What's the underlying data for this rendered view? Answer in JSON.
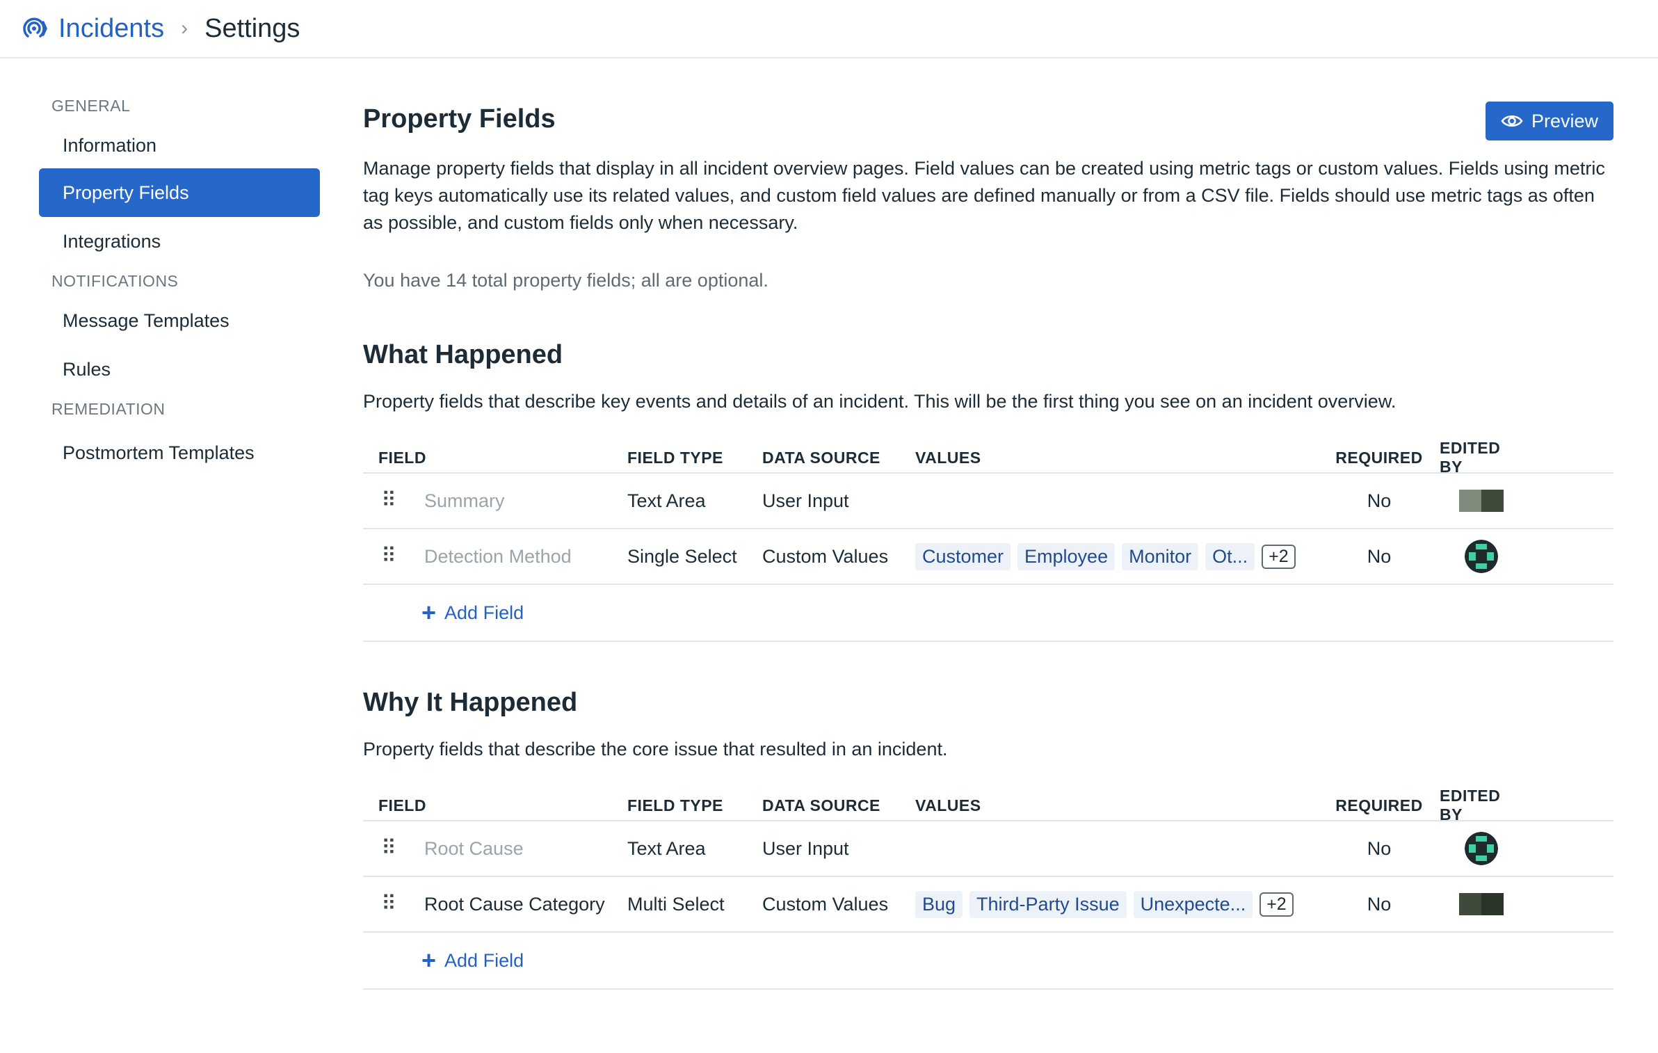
{
  "header": {
    "app": "Incidents",
    "page": "Settings"
  },
  "sidebar": {
    "sections": [
      {
        "title": "GENERAL",
        "items": [
          "Information",
          "Property Fields",
          "Integrations"
        ]
      },
      {
        "title": "NOTIFICATIONS",
        "items": [
          "Message Templates",
          "Rules"
        ]
      },
      {
        "title": "REMEDIATION",
        "items": [
          "Postmortem Templates"
        ]
      }
    ],
    "active": "Property Fields"
  },
  "main": {
    "title": "Property Fields",
    "preview_label": "Preview",
    "description": "Manage property fields that display in all incident overview pages. Field values can be created using metric tags or custom values. Fields using metric tag keys automatically use its related values, and custom field values are defined manually or from a CSV file. Fields should use metric tags as often as possible, and custom fields only when necessary.",
    "summary": "You have 14 total property fields; all are optional."
  },
  "columns": [
    "FIELD",
    "FIELD TYPE",
    "DATA SOURCE",
    "VALUES",
    "REQUIRED",
    "EDITED BY"
  ],
  "add_field_label": "Add Field",
  "sections": [
    {
      "title": "What Happened",
      "description": "Property fields that describe key events and details of an incident. This will be the first thing you see on an incident overview.",
      "rows": [
        {
          "field": "Summary",
          "type": "Text Area",
          "source": "User Input",
          "values": [],
          "more": "",
          "required": "No"
        },
        {
          "field": "Detection Method",
          "type": "Single Select",
          "source": "Custom Values",
          "values": [
            "Customer",
            "Employee",
            "Monitor",
            "Ot..."
          ],
          "more": "+2",
          "required": "No"
        }
      ]
    },
    {
      "title": "Why It Happened",
      "description": "Property fields that describe the core issue that resulted in an incident.",
      "rows": [
        {
          "field": "Root Cause",
          "type": "Text Area",
          "source": "User Input",
          "values": [],
          "more": "",
          "required": "No"
        },
        {
          "field": "Root Cause Category",
          "type": "Multi Select",
          "source": "Custom Values",
          "values": [
            "Bug",
            "Third-Party Issue",
            "Unexpecte..."
          ],
          "more": "+2",
          "required": "No"
        }
      ]
    }
  ],
  "colors": {
    "accent": "#2568c9",
    "link": "#2461c4",
    "chip_bg": "#edf2f8",
    "chip_text": "#234a8c"
  },
  "icons": [
    "incidents-logo-icon",
    "chevron-right-icon",
    "eye-icon",
    "drag-handle-icon",
    "plus-icon"
  ]
}
